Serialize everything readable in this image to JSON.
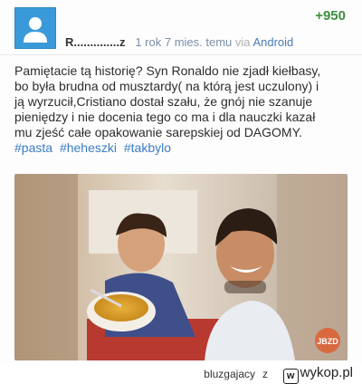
{
  "post": {
    "author": "R..............z",
    "time": "1 rok 7 mies. temu",
    "via_label": "via",
    "platform": "Android",
    "score": "+950",
    "text_lines": [
      "Pamiętacie tą historię? Syn Ronaldo nie zjadł kiełbasy,",
      "bo była brudna od musztardy( na którą jest uczulony) i",
      "ją wyrzucił,Cristiano dostał szału, że gnój nie szanuje",
      "pieniędzy i nie docenia tego co ma i dla nauczki kazał",
      "mu zjeść całe opakowanie sarepskiej od DAGOMY."
    ],
    "tags": [
      "#pasta",
      "#heheszki",
      "#takbylo"
    ],
    "photo_watermark": "JBZD"
  },
  "footer": {
    "username": "bluzgajacy",
    "connector": "z",
    "site_name": "wykop.pl",
    "logo_glyph": "w"
  },
  "colors": {
    "score": "#3c8f3c",
    "tag": "#3b7cc4",
    "avatar": "#3a9ad9"
  }
}
